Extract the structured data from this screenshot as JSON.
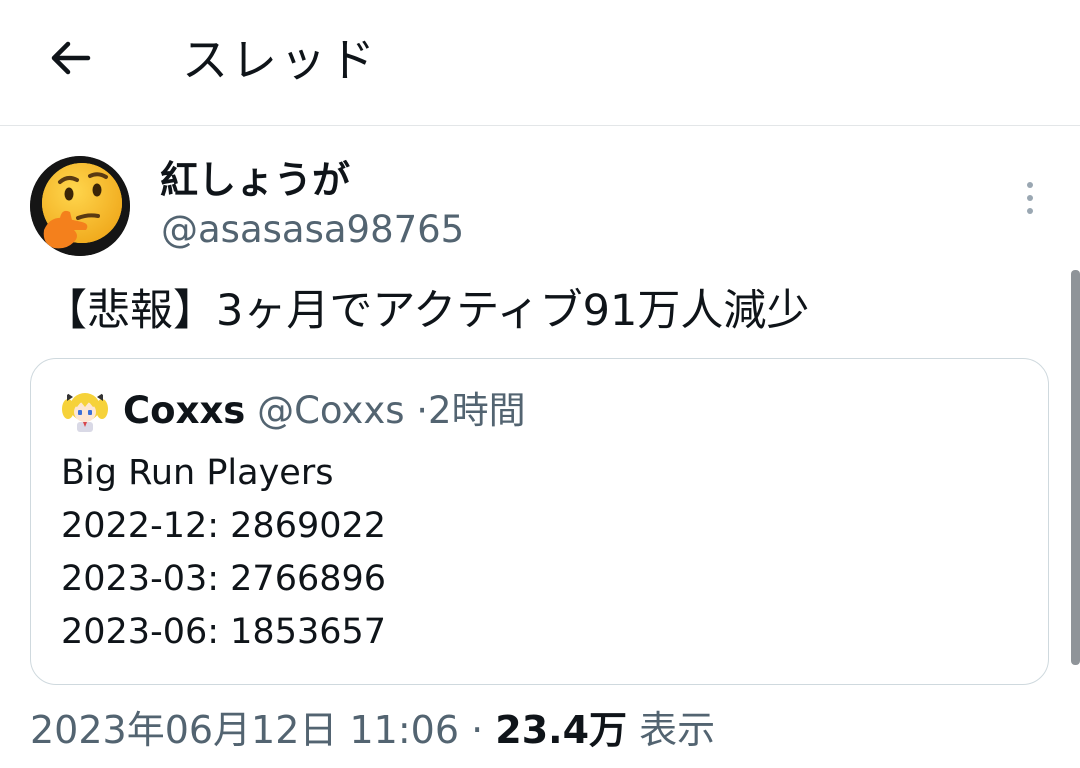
{
  "header": {
    "title": "スレッド",
    "back_icon": "arrow-left-icon"
  },
  "tweet": {
    "author_name": "紅しょうが",
    "author_handle": "@asasasa98765",
    "avatar_icon": "thinking-face-emoji",
    "more_icon": "more-vertical-icon",
    "text": "【悲報】3ヶ月でアクティブ91万人減少",
    "quote": {
      "avatar_icon": "anime-character-avatar",
      "name": "Coxxs",
      "handle": "@Coxxs",
      "separator": "·",
      "time": "2時間",
      "lines": [
        "Big Run Players",
        "2022-12: 2869022",
        "2023-03: 2766896",
        "2023-06: 1853657"
      ]
    },
    "timestamp": "2023年06月12日 11:06",
    "meta_separator": "·",
    "views_count": "23.4万",
    "views_label": "表示"
  },
  "colors": {
    "text_primary": "#0f1419",
    "text_secondary": "#536471",
    "border": "#cfd9de",
    "scrollbar": "#8f9499"
  }
}
